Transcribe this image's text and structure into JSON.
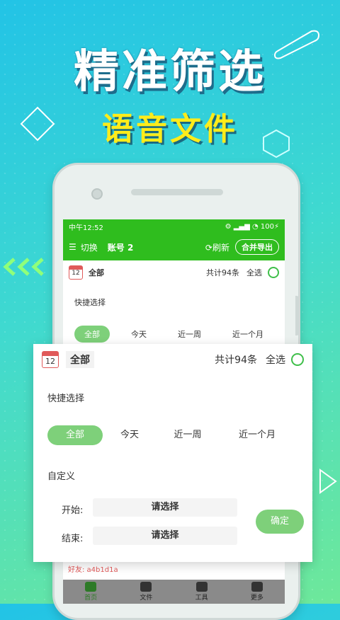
{
  "promo": {
    "headline": "精准筛选",
    "subheadline": "语音文件"
  },
  "status": {
    "time": "中午12:52",
    "battery": "100"
  },
  "appbar": {
    "switch_label": "切换",
    "account": "账号 2",
    "refresh": "刷新",
    "export": "合并导出"
  },
  "calendar_day": "12",
  "bg_filter": {
    "all": "全部",
    "total": "共计94条",
    "select_all": "全选",
    "quick_label": "快捷选择",
    "chips": [
      "全部",
      "今天",
      "近一周",
      "近一个月"
    ]
  },
  "popup": {
    "all": "全部",
    "total": "共计94条",
    "select_all": "全选",
    "quick_label": "快捷选择",
    "chips": [
      "全部",
      "今天",
      "近一周",
      "近一个月"
    ],
    "custom_label": "自定义",
    "start_label": "开始:",
    "start_value": "请选择",
    "end_label": "结束:",
    "end_value": "请选择",
    "confirm": "确定"
  },
  "peek_row": {
    "friend": "好友: a4b1d1a"
  },
  "tabs": [
    {
      "label": "首页"
    },
    {
      "label": "文件"
    },
    {
      "label": "工具"
    },
    {
      "label": "更多"
    }
  ],
  "colors": {
    "brand_green": "#2fbd1e",
    "chip_green": "#7ed07a",
    "headline_yellow": "#ffec1a"
  }
}
